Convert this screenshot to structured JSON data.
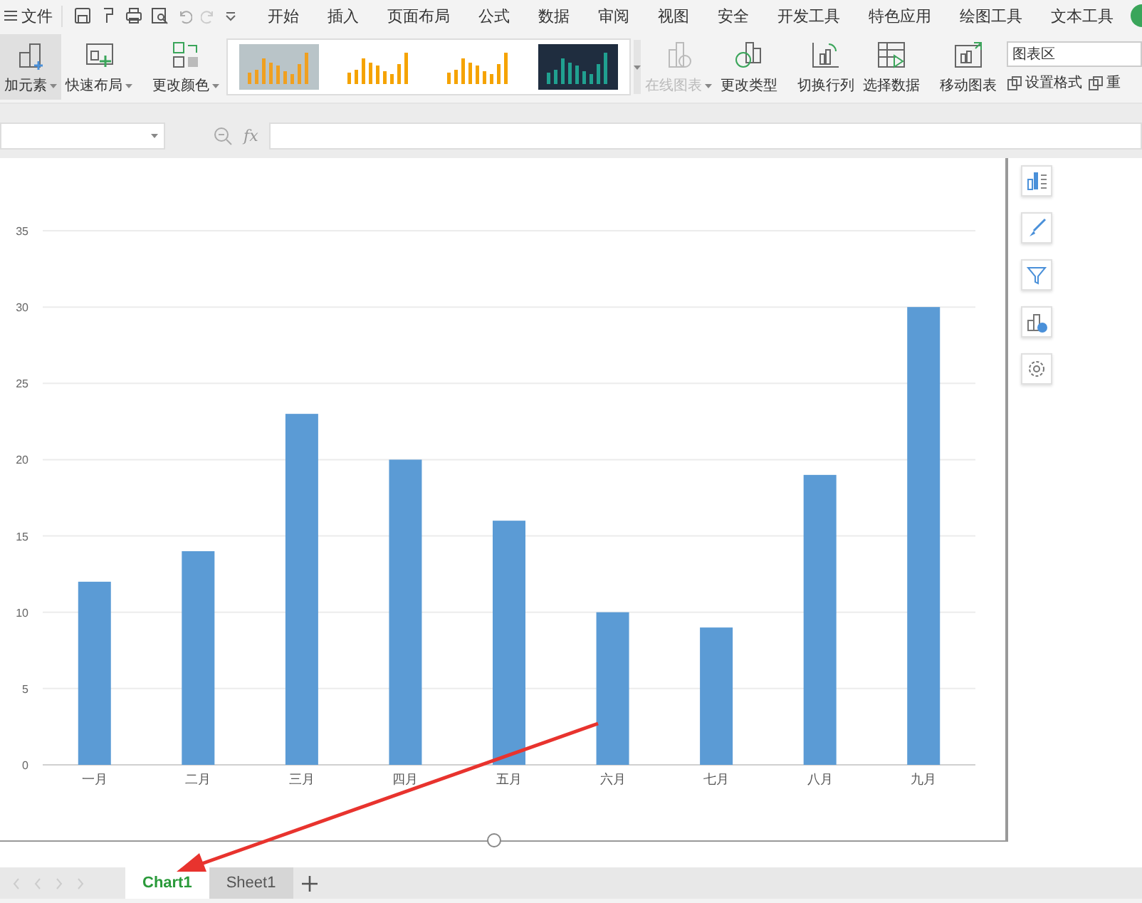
{
  "menu_bar": {
    "file_label": "文件",
    "tabs": [
      {
        "label": "开始",
        "selected": false
      },
      {
        "label": "插入",
        "selected": false
      },
      {
        "label": "页面布局",
        "selected": false
      },
      {
        "label": "公式",
        "selected": false
      },
      {
        "label": "数据",
        "selected": false
      },
      {
        "label": "审阅",
        "selected": false
      },
      {
        "label": "视图",
        "selected": false
      },
      {
        "label": "安全",
        "selected": false
      },
      {
        "label": "开发工具",
        "selected": false
      },
      {
        "label": "特色应用",
        "selected": false
      },
      {
        "label": "绘图工具",
        "selected": false
      },
      {
        "label": "文本工具",
        "selected": false
      }
    ]
  },
  "ribbon": {
    "left_buttons": [
      {
        "label": "加元素",
        "dropdown": true,
        "highlighted": true
      },
      {
        "label": "快速布局",
        "dropdown": true,
        "highlighted": false
      },
      {
        "label": "更改颜色",
        "dropdown": true,
        "highlighted": false
      }
    ],
    "gallery": [
      {
        "kind": "gray"
      },
      {
        "kind": "white"
      },
      {
        "kind": "white"
      },
      {
        "kind": "dark"
      }
    ],
    "right_buttons": [
      {
        "label": "在线图表",
        "dropdown": true,
        "disabled": true
      },
      {
        "label": "更改类型",
        "dropdown": false,
        "disabled": false
      },
      {
        "label": "切换行列",
        "dropdown": false,
        "disabled": false
      },
      {
        "label": "选择数据",
        "dropdown": false,
        "disabled": false
      },
      {
        "label": "移动图表",
        "dropdown": false,
        "disabled": false
      }
    ],
    "element_field": {
      "value": "图表区"
    },
    "small_buttons": [
      {
        "label": "设置格式"
      },
      {
        "label": "重"
      }
    ]
  },
  "formula_bar": {
    "fx_label": "fx"
  },
  "chart": {
    "chart_data": {
      "type": "bar",
      "categories": [
        "一月",
        "二月",
        "三月",
        "四月",
        "五月",
        "六月",
        "七月",
        "八月",
        "九月"
      ],
      "series": [
        {
          "color": "#5b9bd5",
          "values": [
            12,
            14,
            23,
            20,
            16,
            10,
            9,
            19,
            30
          ]
        }
      ],
      "grid": true,
      "ylim": [
        0,
        35
      ],
      "yticks": [
        0,
        5,
        10,
        15,
        20,
        25,
        30,
        35
      ]
    }
  },
  "sheet_tabs": [
    {
      "label": "Chart1",
      "selected": true
    },
    {
      "label": "Sheet1",
      "selected": false
    }
  ]
}
